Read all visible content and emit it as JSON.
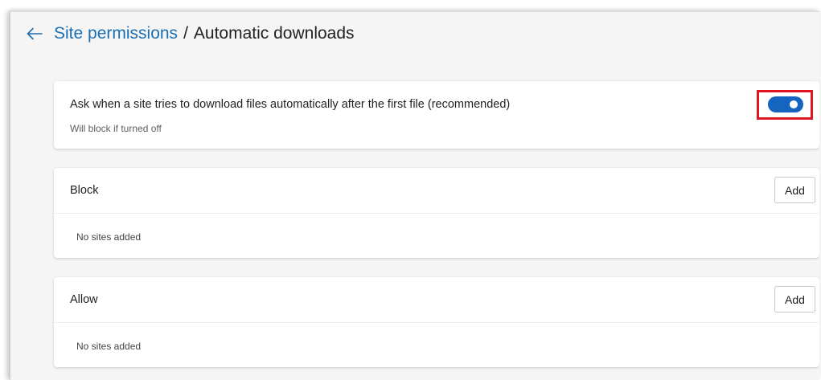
{
  "header": {
    "back_icon": "arrow-left-icon",
    "breadcrumb_parent": "Site permissions",
    "separator": "/",
    "title": "Automatic downloads"
  },
  "setting": {
    "label": "Ask when a site tries to download files automatically after the first file (recommended)",
    "description": "Will block if turned off",
    "toggle_on": true
  },
  "block": {
    "title": "Block",
    "add_label": "Add",
    "empty_text": "No sites added"
  },
  "allow": {
    "title": "Allow",
    "add_label": "Add",
    "empty_text": "No sites added"
  },
  "colors": {
    "link": "#1b6fb3",
    "toggle_on": "#1565c0",
    "highlight": "#e0141e"
  }
}
